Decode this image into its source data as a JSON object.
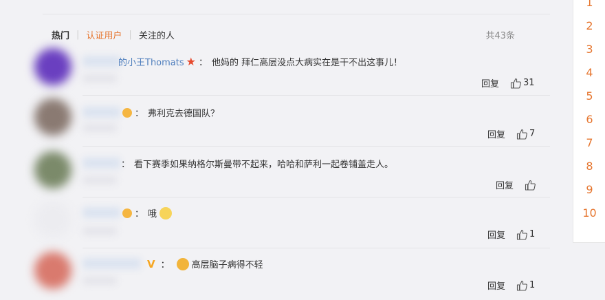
{
  "tabs": {
    "hot": "热门",
    "verified": "认证用户",
    "following": "关注的人"
  },
  "total_count": "共43条",
  "comments": [
    {
      "username": "的小王Thomats",
      "text": "他妈的 拜仁高层没点大病实在是干不出这事儿！",
      "reply": "回复",
      "likes": "31"
    },
    {
      "username": "",
      "text": "弗利克去德国队？",
      "reply": "回复",
      "likes": "7"
    },
    {
      "username": "",
      "text": "看下赛季如果纳格尔斯曼带不起来，哈哈和萨利一起卷铺盖走人。",
      "reply": "回复",
      "likes": ""
    },
    {
      "username": "",
      "text": "哦",
      "reply": "回复",
      "likes": "1"
    },
    {
      "username": "",
      "text": "高层脑子病得不轻",
      "reply": "回复",
      "likes": "1"
    }
  ],
  "pagination": [
    "1",
    "2",
    "3",
    "4",
    "5",
    "6",
    "7",
    "8",
    "9",
    "10"
  ],
  "colors": {
    "accent": "#e6762f",
    "link": "#4e7ebd",
    "background": "#f2f2f5"
  }
}
